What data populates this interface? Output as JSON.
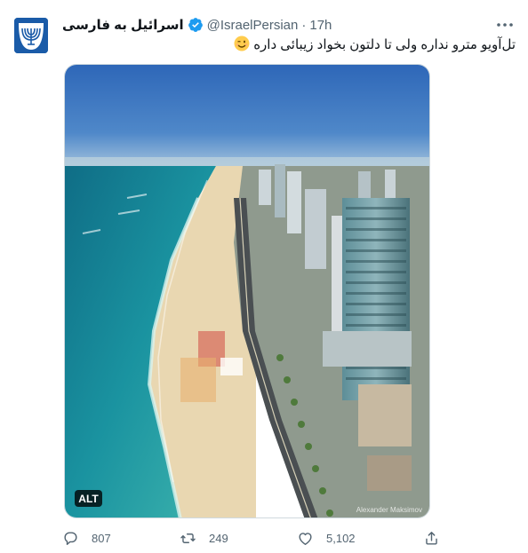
{
  "tweet": {
    "display_name": "اسرائیل به فارسی",
    "handle": "@IsraelPersian",
    "separator": "·",
    "time": "17h",
    "text": "تل‌آویو مترو نداره ولی تا دلتون بخواد زیبائی داره",
    "emoji": "winking-face",
    "media": {
      "alt_badge": "ALT",
      "credit": "Alexander Maksimov"
    },
    "actions": {
      "replies": "807",
      "retweets": "249",
      "likes": "5,102"
    }
  },
  "colors": {
    "text_primary": "#0f1419",
    "text_secondary": "#536471",
    "verified": "#1d9bf0",
    "avatar_bg": "#1a5ba8"
  }
}
